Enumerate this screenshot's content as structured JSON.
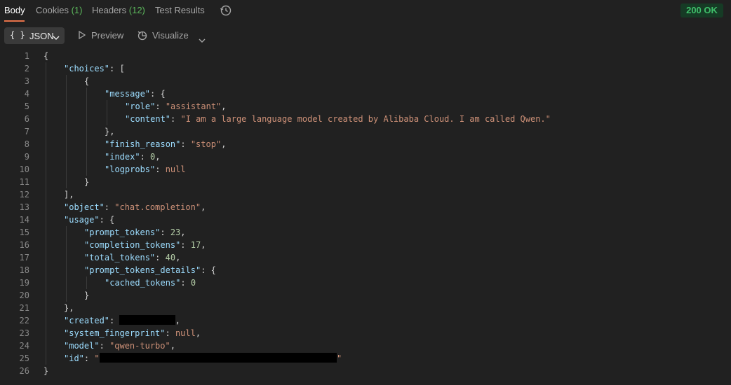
{
  "tabs": [
    {
      "label": "Body",
      "count": ""
    },
    {
      "label": "Cookies",
      "count": "(1)"
    },
    {
      "label": "Headers",
      "count": "(12)"
    },
    {
      "label": "Test Results",
      "count": ""
    }
  ],
  "status": "200 OK",
  "toolbar": {
    "format_label": "JSON",
    "format_icon": "{ }",
    "preview_label": "Preview",
    "visualize_label": "Visualize"
  },
  "lines": [
    [
      {
        "t": "p",
        "v": "{"
      }
    ],
    [
      {
        "t": "k",
        "v": "\"choices\""
      },
      {
        "t": "p",
        "v": ": ["
      }
    ],
    [
      {
        "t": "p",
        "v": "{"
      }
    ],
    [
      {
        "t": "k",
        "v": "\"message\""
      },
      {
        "t": "p",
        "v": ": {"
      }
    ],
    [
      {
        "t": "k",
        "v": "\"role\""
      },
      {
        "t": "p",
        "v": ": "
      },
      {
        "t": "s",
        "v": "\"assistant\""
      },
      {
        "t": "p",
        "v": ","
      }
    ],
    [
      {
        "t": "k",
        "v": "\"content\""
      },
      {
        "t": "p",
        "v": ": "
      },
      {
        "t": "s",
        "v": "\"I am a large language model created by Alibaba Cloud. I am called Qwen.\""
      }
    ],
    [
      {
        "t": "p",
        "v": "},"
      }
    ],
    [
      {
        "t": "k",
        "v": "\"finish_reason\""
      },
      {
        "t": "p",
        "v": ": "
      },
      {
        "t": "s",
        "v": "\"stop\""
      },
      {
        "t": "p",
        "v": ","
      }
    ],
    [
      {
        "t": "k",
        "v": "\"index\""
      },
      {
        "t": "p",
        "v": ": "
      },
      {
        "t": "n",
        "v": "0"
      },
      {
        "t": "p",
        "v": ","
      }
    ],
    [
      {
        "t": "k",
        "v": "\"logprobs\""
      },
      {
        "t": "p",
        "v": ": "
      },
      {
        "t": "nl",
        "v": "null"
      }
    ],
    [
      {
        "t": "p",
        "v": "}"
      }
    ],
    [
      {
        "t": "p",
        "v": "],"
      }
    ],
    [
      {
        "t": "k",
        "v": "\"object\""
      },
      {
        "t": "p",
        "v": ": "
      },
      {
        "t": "s",
        "v": "\"chat.completion\""
      },
      {
        "t": "p",
        "v": ","
      }
    ],
    [
      {
        "t": "k",
        "v": "\"usage\""
      },
      {
        "t": "p",
        "v": ": {"
      }
    ],
    [
      {
        "t": "k",
        "v": "\"prompt_tokens\""
      },
      {
        "t": "p",
        "v": ": "
      },
      {
        "t": "n",
        "v": "23"
      },
      {
        "t": "p",
        "v": ","
      }
    ],
    [
      {
        "t": "k",
        "v": "\"completion_tokens\""
      },
      {
        "t": "p",
        "v": ": "
      },
      {
        "t": "n",
        "v": "17"
      },
      {
        "t": "p",
        "v": ","
      }
    ],
    [
      {
        "t": "k",
        "v": "\"total_tokens\""
      },
      {
        "t": "p",
        "v": ": "
      },
      {
        "t": "n",
        "v": "40"
      },
      {
        "t": "p",
        "v": ","
      }
    ],
    [
      {
        "t": "k",
        "v": "\"prompt_tokens_details\""
      },
      {
        "t": "p",
        "v": ": {"
      }
    ],
    [
      {
        "t": "k",
        "v": "\"cached_tokens\""
      },
      {
        "t": "p",
        "v": ": "
      },
      {
        "t": "n",
        "v": "0"
      }
    ],
    [
      {
        "t": "p",
        "v": "}"
      }
    ],
    [
      {
        "t": "p",
        "v": "},"
      }
    ],
    [
      {
        "t": "k",
        "v": "\"created\""
      },
      {
        "t": "p",
        "v": ": "
      },
      {
        "t": "r",
        "v": "",
        "w": 11
      },
      {
        "t": "p",
        "v": ","
      }
    ],
    [
      {
        "t": "k",
        "v": "\"system_fingerprint\""
      },
      {
        "t": "p",
        "v": ": "
      },
      {
        "t": "nl",
        "v": "null"
      },
      {
        "t": "p",
        "v": ","
      }
    ],
    [
      {
        "t": "k",
        "v": "\"model\""
      },
      {
        "t": "p",
        "v": ": "
      },
      {
        "t": "s",
        "v": "\"qwen-turbo\""
      },
      {
        "t": "p",
        "v": ","
      }
    ],
    [
      {
        "t": "k",
        "v": "\"id\""
      },
      {
        "t": "p",
        "v": ": "
      },
      {
        "t": "s",
        "v": "\""
      },
      {
        "t": "r",
        "v": "",
        "w": 47
      },
      {
        "t": "s",
        "v": "\""
      }
    ],
    [
      {
        "t": "p",
        "v": "}"
      }
    ]
  ],
  "indents": [
    0,
    1,
    2,
    3,
    4,
    4,
    3,
    3,
    3,
    3,
    2,
    1,
    1,
    1,
    2,
    2,
    2,
    2,
    3,
    2,
    1,
    1,
    1,
    1,
    1,
    0
  ]
}
